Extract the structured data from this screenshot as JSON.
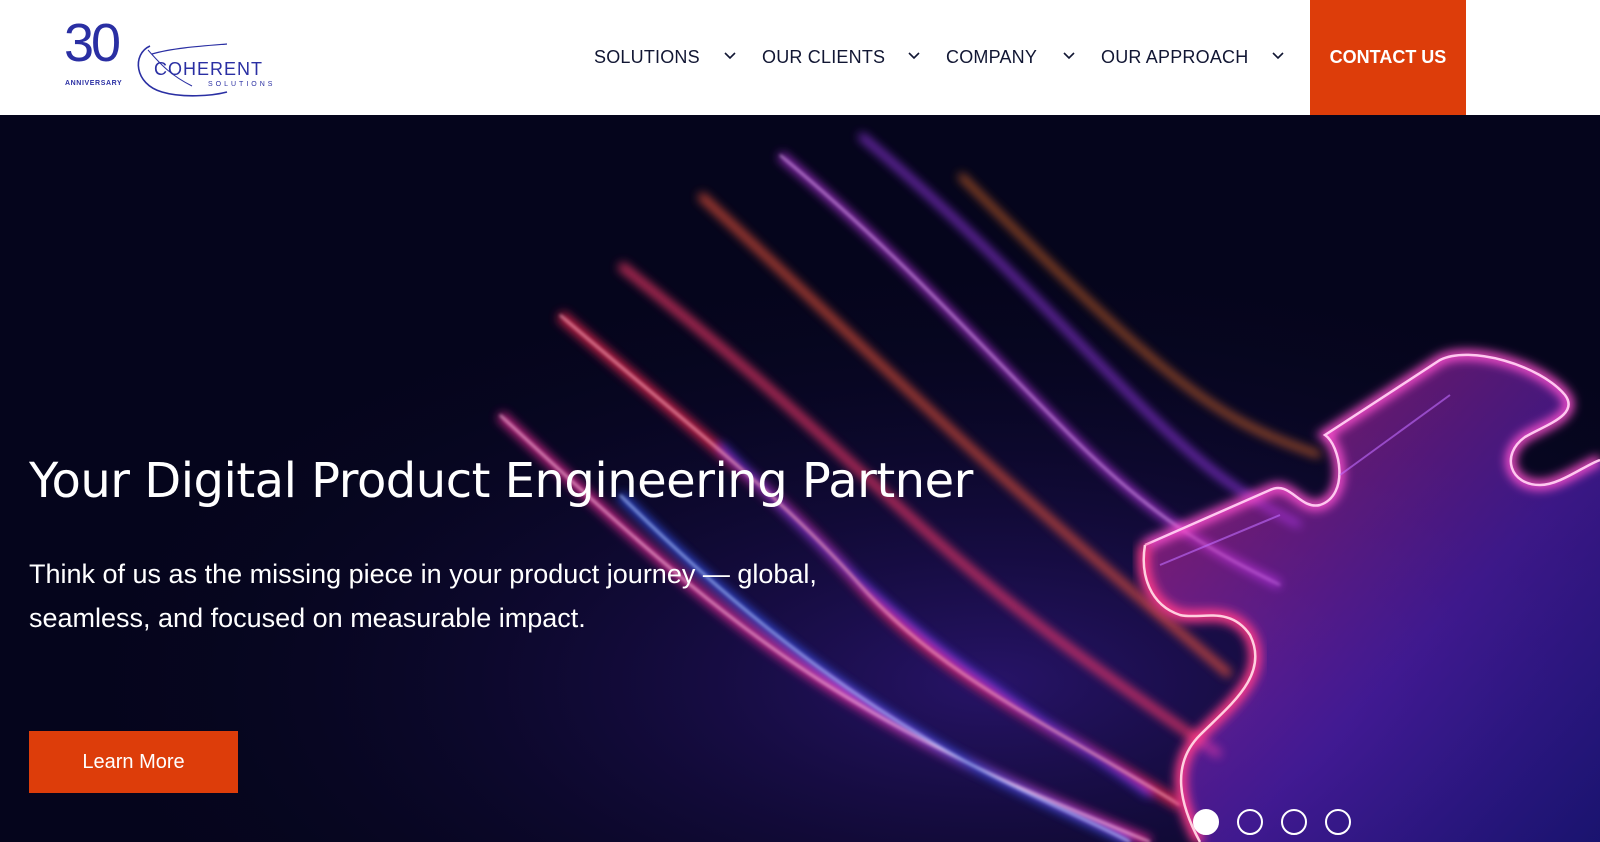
{
  "logo": {
    "anniversary_number": "30",
    "anniversary_label": "ANNIVERSARY",
    "brand_name": "COHERENT",
    "brand_sub": "SOLUTIONS"
  },
  "nav": {
    "items": [
      {
        "label": "SOLUTIONS",
        "icon": "chevron-down-icon"
      },
      {
        "label": "OUR CLIENTS",
        "icon": "chevron-down-icon"
      },
      {
        "label": "COMPANY",
        "icon": "chevron-down-icon"
      },
      {
        "label": "OUR APPROACH",
        "icon": "chevron-down-icon"
      }
    ],
    "contact_label": "CONTACT US"
  },
  "hero": {
    "title": "Your Digital Product Engineering Partner",
    "subtitle": "Think of us as the missing piece in your product journey — global, seamless, and focused on measurable impact.",
    "cta_label": "Learn More",
    "carousel": {
      "slide_count": 4,
      "active_slide": 1
    }
  },
  "colors": {
    "brand_blue": "#2a2fa3",
    "accent_orange": "#dd3d0a",
    "hero_background": "#05051c",
    "nav_text": "#111633"
  }
}
